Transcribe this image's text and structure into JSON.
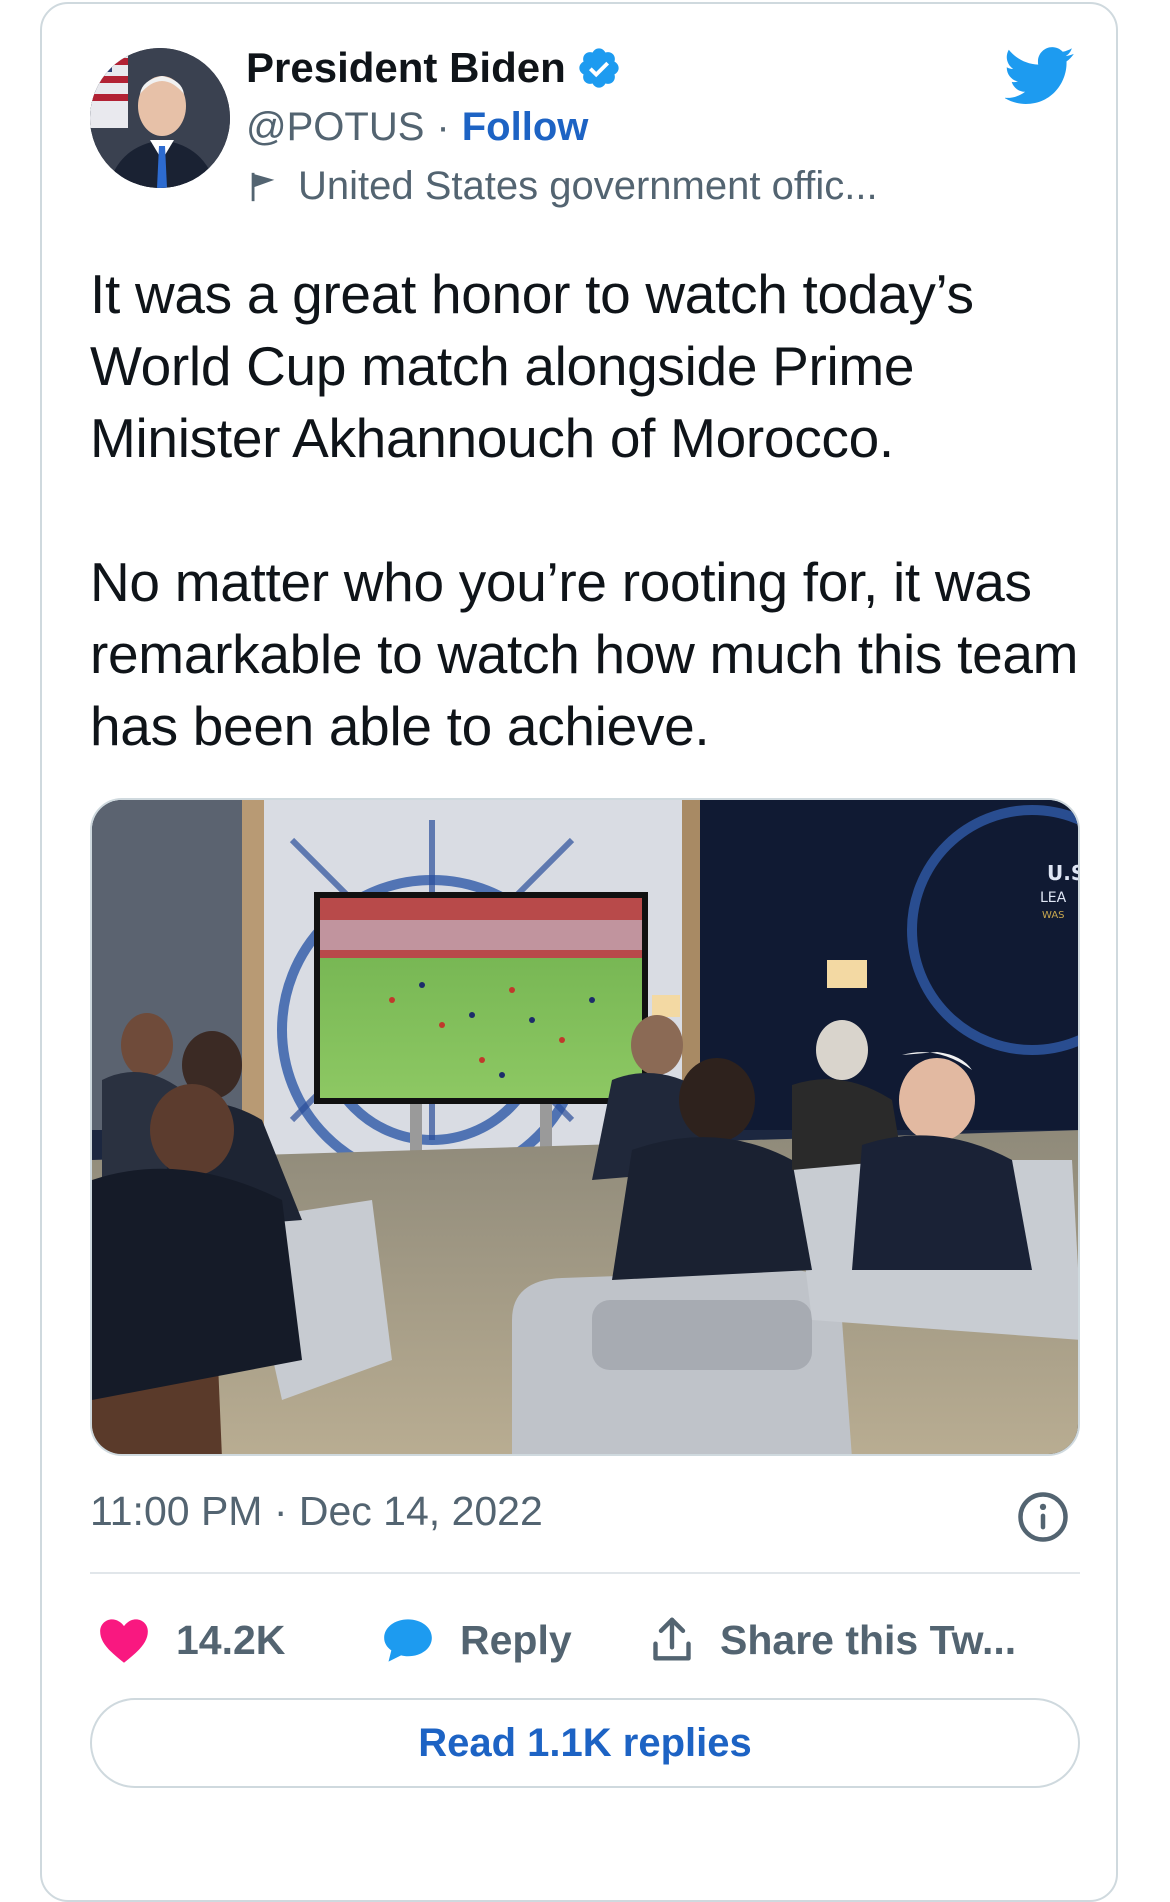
{
  "author": {
    "name": "President Biden",
    "handle": "@POTUS",
    "separator": "·",
    "follow_label": "Follow",
    "account_label": "United States government offic..."
  },
  "tweet": {
    "text": "It was a great honor to watch today’s World Cup match alongside Prime Minister Akhannouch of Morocco.\n\nNo matter who you’re rooting for, it was remarkable to watch how much this team has been able to achieve.",
    "timestamp": "11:00 PM · Dec 14, 2022"
  },
  "actions": {
    "likes": "14.2K",
    "reply_label": "Reply",
    "share_label": "Share this Tw..."
  },
  "read_replies_label": "Read 1.1K replies",
  "photo_sign_text": [
    "U.S",
    "LEA",
    "WAS"
  ],
  "colors": {
    "accent": "#1d63c4",
    "twitter_blue": "#1d9bf0",
    "like_pink": "#f91880",
    "muted_text": "#536471",
    "border": "#cfd9de"
  },
  "icons": [
    "verified-icon",
    "twitter-bird-icon",
    "government-flag-icon",
    "info-icon",
    "heart-icon",
    "reply-bubble-icon",
    "share-icon"
  ]
}
